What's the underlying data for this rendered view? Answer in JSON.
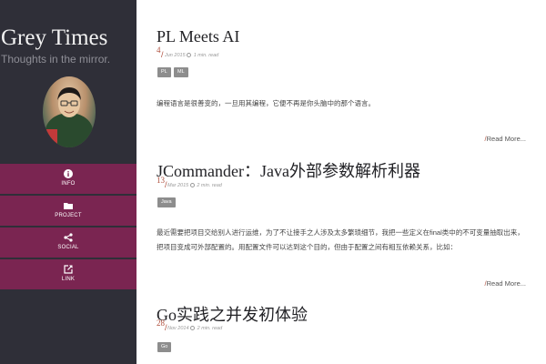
{
  "site": {
    "title": "Grey Times",
    "tagline": "Thoughts in the mirror."
  },
  "nav": [
    {
      "label": "INFO",
      "icon": "info-icon"
    },
    {
      "label": "PROJECT",
      "icon": "folder-icon"
    },
    {
      "label": "SOCIAL",
      "icon": "share-icon"
    },
    {
      "label": "LINK",
      "icon": "external-link-icon"
    }
  ],
  "posts": [
    {
      "title": "PL Meets AI",
      "day": "4",
      "date": "Jun 2015",
      "read_time": "1 min. read",
      "tags": [
        "PL",
        "ML"
      ],
      "excerpt": "编程语言是很善变的，一旦用其编程，它便不再是你头脑中的那个语言。",
      "read_more": "Read More..."
    },
    {
      "title": "JCommander：Java外部参数解析利器",
      "day": "13",
      "date": "Mar 2015",
      "read_time": "2 min. read",
      "tags": [
        "Java"
      ],
      "excerpt": "最近需要把项目交给别人进行运维，为了不让接手之人涉及太多繁琐细节，我把一些定义在final类中的不可变量抽取出来，把项目变成可外部配置的。用配置文件可以达到这个目的，但由于配置之间有相互依赖关系，比如：",
      "read_more": "Read More..."
    },
    {
      "title": "Go实践之并发初体验",
      "day": "28",
      "date": "Nov 2014",
      "read_time": "2 min. read",
      "tags": [
        "Go"
      ]
    }
  ],
  "colors": {
    "sidebar_bg": "#2f2f38",
    "nav_bg": "#7a2551",
    "accent": "#b0503e",
    "tag_bg": "#8d8d8d"
  }
}
